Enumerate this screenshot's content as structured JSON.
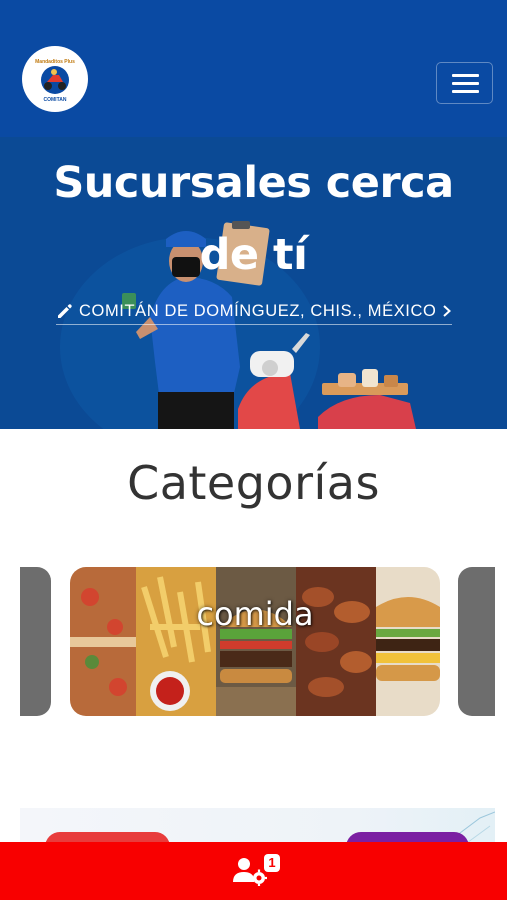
{
  "header": {
    "logo": {
      "top_text": "Mandaditos Plus",
      "bottom_text": "COMITAN"
    },
    "menu_icon": "hamburger-menu-icon"
  },
  "hero": {
    "title_line1": "Sucursales cerca",
    "title_line2": "de tí",
    "location": "COMITÁN DE DOMÍNGUEZ, CHIS., MÉXICO",
    "edit_icon": "pencil-icon",
    "arrow_icon": "chevron-right-icon"
  },
  "categories": {
    "title": "Categorías",
    "items": [
      {
        "label": "comida"
      }
    ]
  },
  "bottom_bar": {
    "icon": "users-gear-icon",
    "badge_count": "1",
    "color": "#f80000"
  },
  "colors": {
    "primary_blue": "#0a4aa3",
    "bottom_red": "#f80000",
    "pill_red": "#e83c3c",
    "pill_purple": "#7b1fa2"
  }
}
